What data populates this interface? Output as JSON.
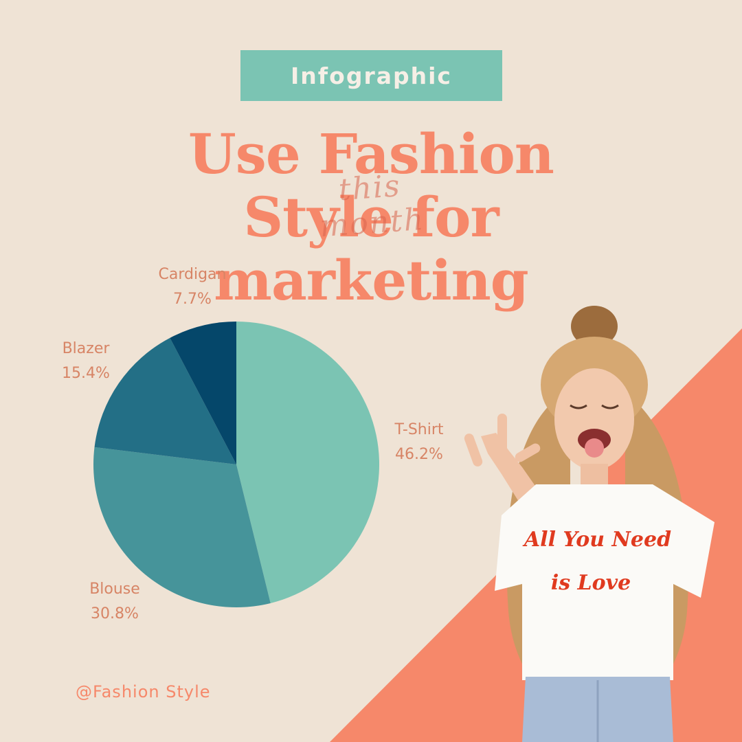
{
  "badge": "Infographic",
  "headline": {
    "line1": "Use Fashion",
    "line2": "Style for",
    "line3": "marketing"
  },
  "script_overlay": "this month",
  "handle": "@Fashion Style",
  "shirt_text": {
    "line1": "All You Need",
    "line2": "is Love"
  },
  "colors": {
    "background": "#efe3d5",
    "accent_coral": "#f6886a",
    "badge_teal": "#7bc4b3",
    "label_text": "#d78465"
  },
  "chart_data": {
    "type": "pie",
    "slices": [
      {
        "label": "T-Shirt",
        "value": 46.2,
        "display": "46.2%",
        "color": "#7bc4b3"
      },
      {
        "label": "Blouse",
        "value": 30.8,
        "display": "30.8%",
        "color": "#46949a"
      },
      {
        "label": "Blazer",
        "value": 15.4,
        "display": "15.4%",
        "color": "#236f86"
      },
      {
        "label": "Cardigan",
        "value": 7.7,
        "display": "7.7%",
        "color": "#05476a"
      }
    ],
    "start_angle_deg": 0,
    "direction": "clockwise",
    "legend": "none"
  }
}
